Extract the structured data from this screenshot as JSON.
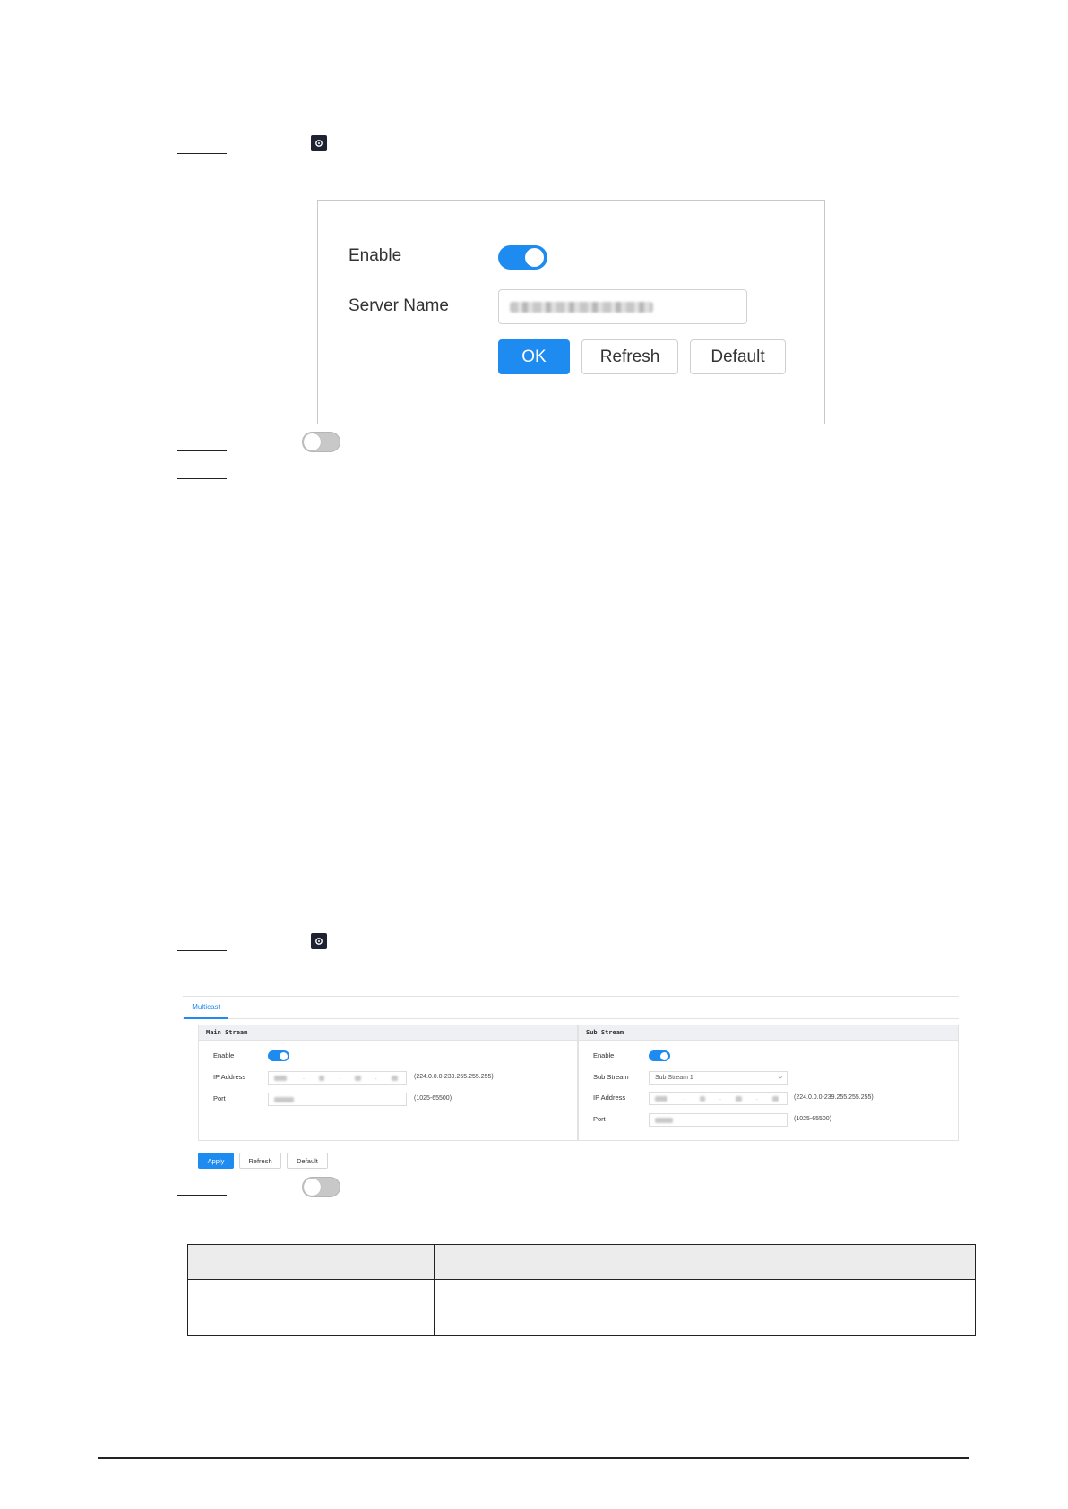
{
  "dialog1": {
    "enable_label": "Enable",
    "server_name_label": "Server Name",
    "ok_label": "OK",
    "refresh_label": "Refresh",
    "default_label": "Default",
    "enable_state": "on"
  },
  "dialog2": {
    "tab_label": "Multicast",
    "main_stream": {
      "title": "Main Stream",
      "enable_label": "Enable",
      "ip_label": "IP Address",
      "ip_range": "(224.0.0.0-239.255.255.255)",
      "port_label": "Port",
      "port_range": "(1025-65500)"
    },
    "sub_stream": {
      "title": "Sub Stream",
      "enable_label": "Enable",
      "stream_label": "Sub Stream",
      "stream_value": "Sub Stream 1",
      "ip_label": "IP Address",
      "ip_range": "(224.0.0.0-239.255.255.255)",
      "port_label": "Port",
      "port_range": "(1025-65500)"
    },
    "apply_label": "Apply",
    "refresh_label": "Refresh",
    "default_label": "Default"
  },
  "icons": {
    "gear": "gear-icon",
    "toggle": "toggle-icon"
  },
  "colors": {
    "accent": "#1e8bf0",
    "toggle_off": "#c8c8c8"
  }
}
